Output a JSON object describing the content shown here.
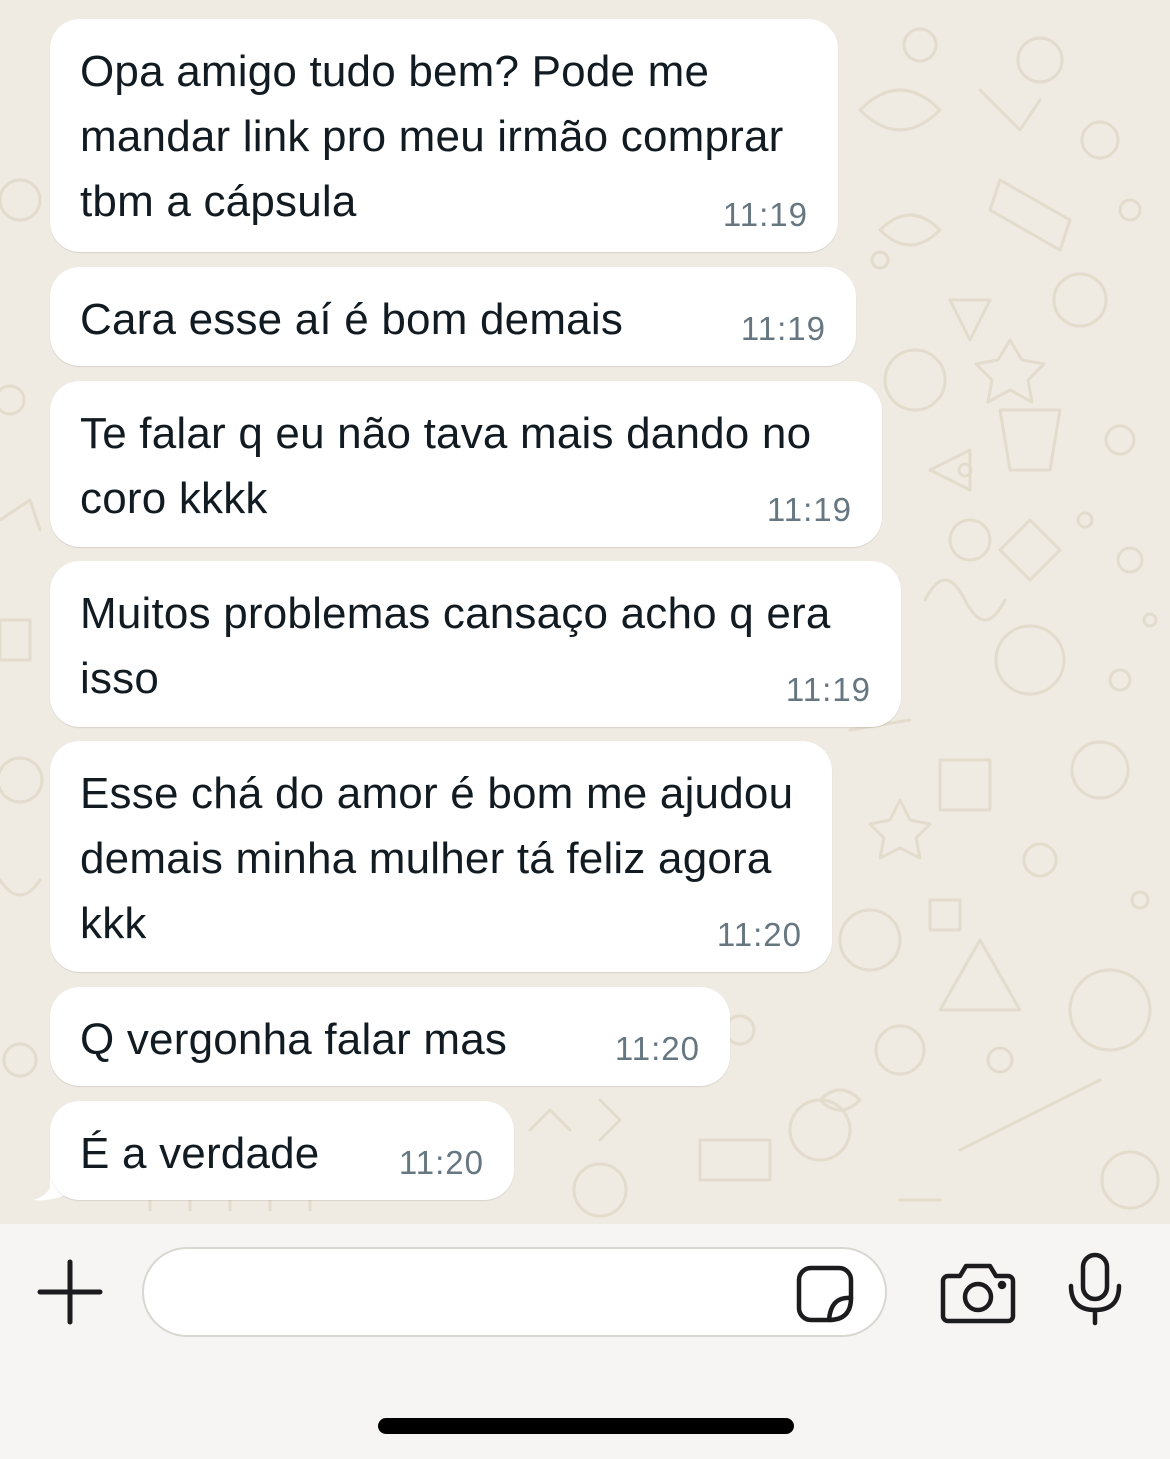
{
  "colors": {
    "chat_background": "#efeae2",
    "bubble_background": "#ffffff",
    "message_text": "#111b21",
    "timestamp_text": "#667781",
    "input_bar_background": "#f6f5f3",
    "icon_color": "#1c1c1e"
  },
  "messages": [
    {
      "text": "Opa amigo tudo bem? Pode me mandar link pro meu irmão comprar tbm a cápsula",
      "time": "11:19"
    },
    {
      "text": "Cara esse aí é bom demais",
      "time": "11:19"
    },
    {
      "text": "Te falar q eu não tava mais dando no coro kkkk",
      "time": "11:19"
    },
    {
      "text": "Muitos problemas cansaço acho q era isso",
      "time": "11:19"
    },
    {
      "text": "Esse chá do amor é bom me ajudou demais minha mulher tá feliz agora kkk",
      "time": "11:20"
    },
    {
      "text": "Q vergonha falar mas",
      "time": "11:20"
    },
    {
      "text": "É a verdade",
      "time": "11:20"
    }
  ],
  "input_bar": {
    "message_value": "",
    "icons": {
      "attach": "plus-icon",
      "sticker": "sticker-icon",
      "camera": "camera-icon",
      "voice": "microphone-icon"
    }
  }
}
